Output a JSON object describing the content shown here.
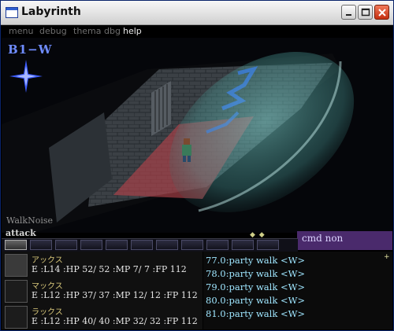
{
  "window": {
    "title": "Labyrinth"
  },
  "menu": {
    "items": [
      "menu",
      "debug",
      "thema dbg",
      "help"
    ]
  },
  "hud": {
    "floor": "B1−W",
    "walk_noise": "WalkNoise",
    "command": "attack",
    "cmd_status": "cmd non",
    "dots": "◆ ◆",
    "plus": "+"
  },
  "party": [
    {
      "name": "アックス",
      "stats": "E :L14 :HP 52/ 52 :MP 7/ 7 :FP 112"
    },
    {
      "name": "マックス",
      "stats": "E :L12 :HP 37/ 37 :MP 12/ 12 :FP 112"
    },
    {
      "name": "ラックス",
      "stats": "E :L12 :HP 40/ 40 :MP 32/ 32 :FP 112"
    }
  ],
  "log": [
    "77.0:party walk <W>",
    "78.0:party walk <W>",
    "79.0:party walk <W>",
    "80.0:party walk <W>",
    "81.0:party walk <W>"
  ],
  "colors": {
    "accent": "#6f8cff",
    "cmd_bg": "#4a2a6c",
    "log_text": "#9fe6ff",
    "floor_tint": "#c0404a",
    "light_cone": "#6fc4c0"
  }
}
